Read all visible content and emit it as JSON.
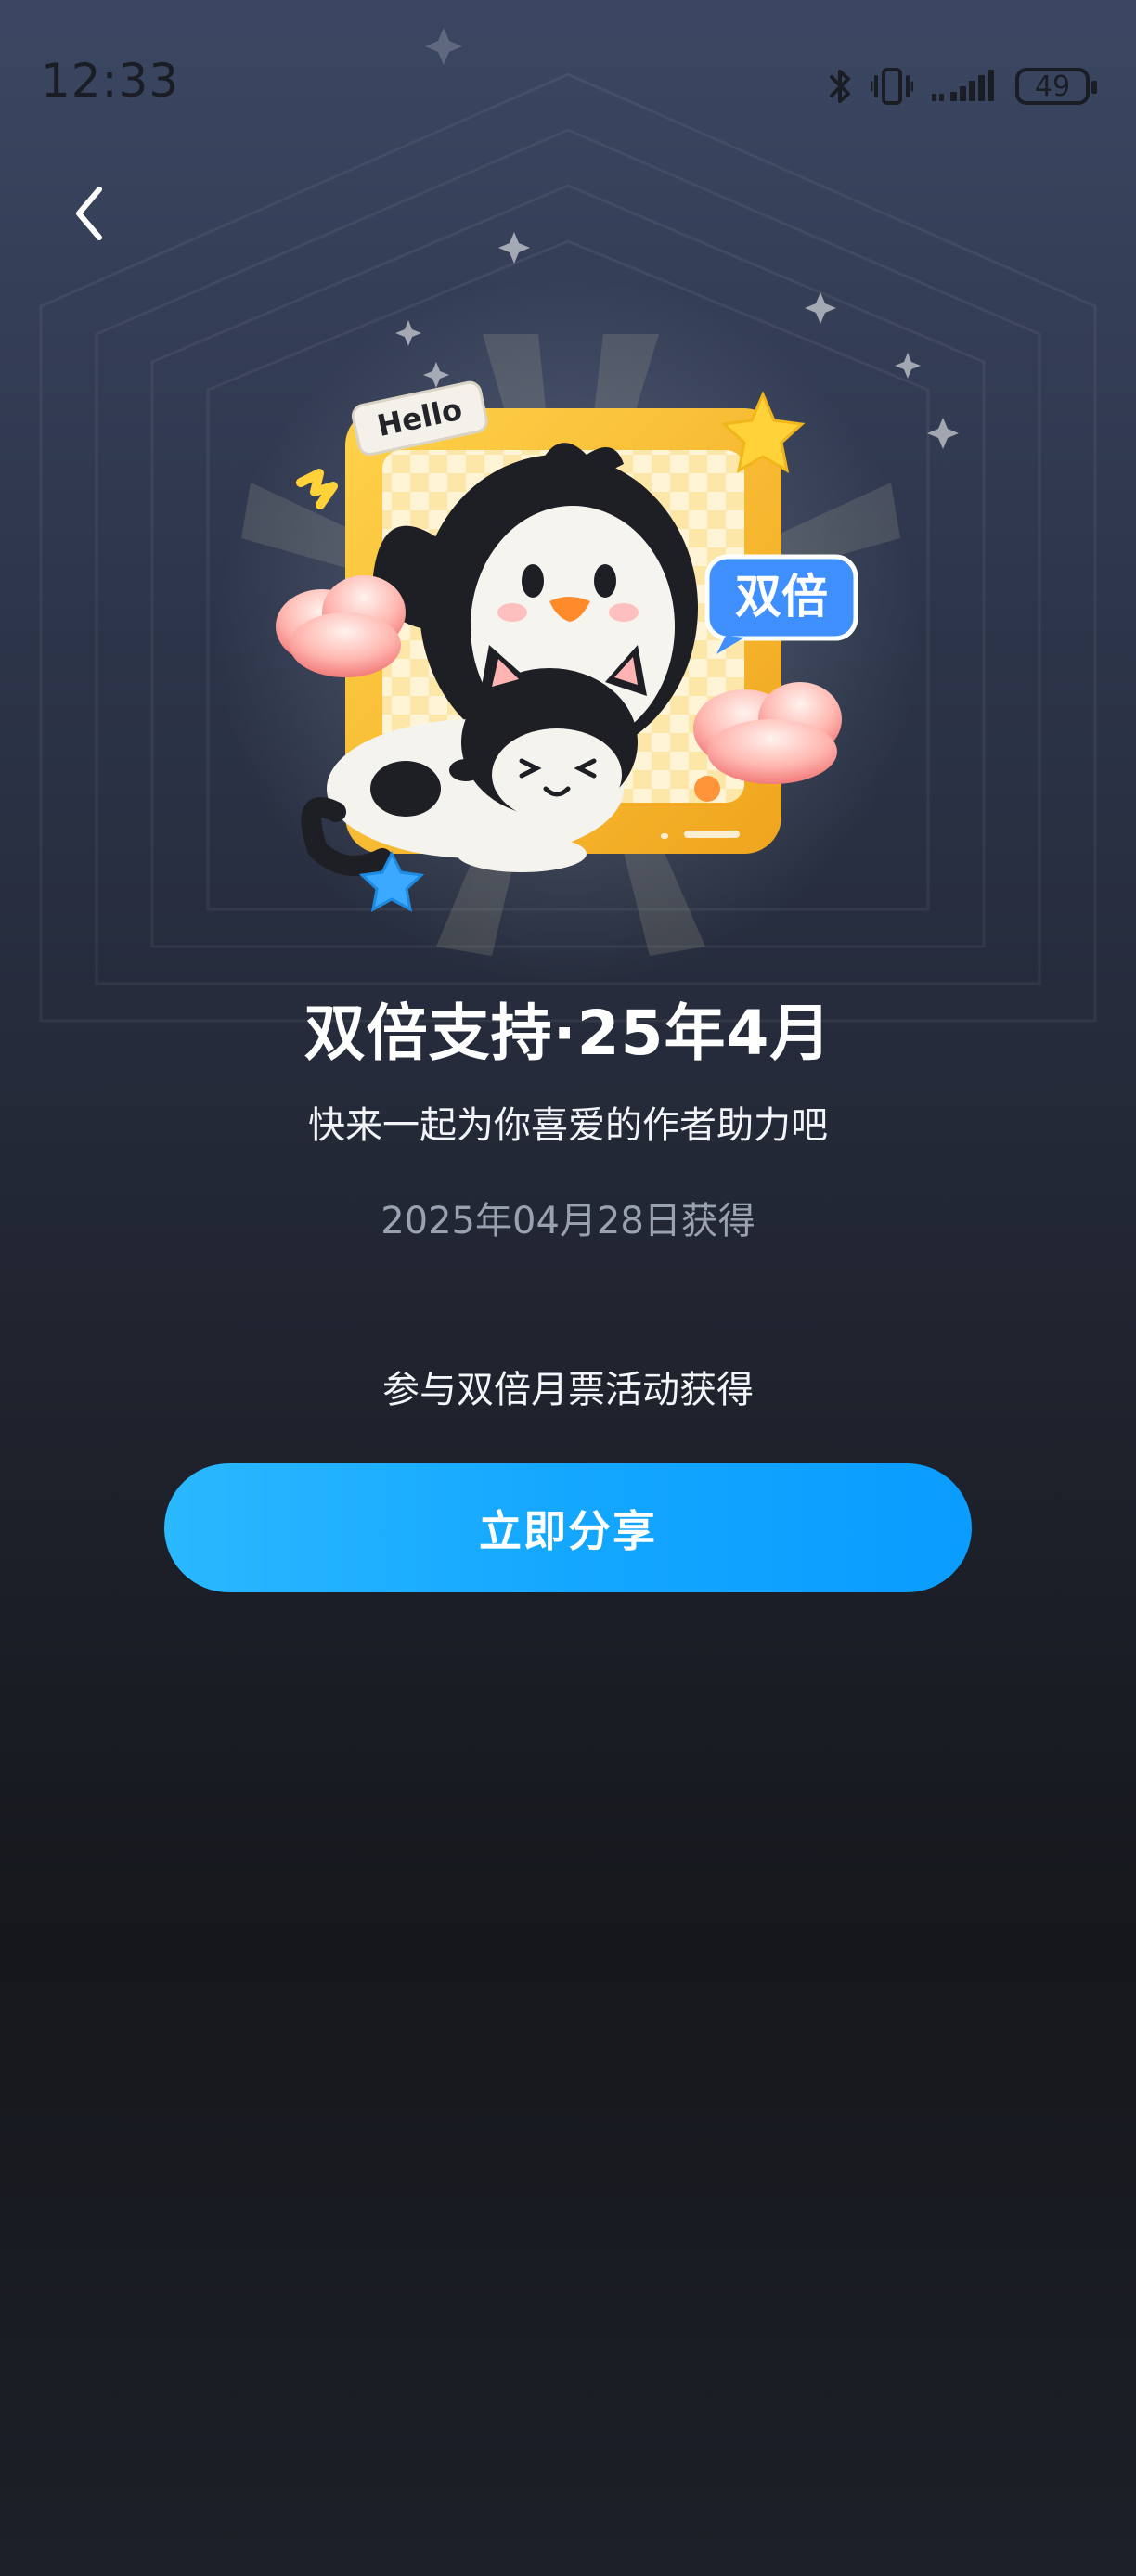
{
  "status_bar": {
    "time": "12:33",
    "battery": "49",
    "icons": [
      "bluetooth-icon",
      "vibrate-icon",
      "signal-icon",
      "battery-icon"
    ]
  },
  "nav": {
    "back_icon": "chevron-left-icon"
  },
  "badge": {
    "hello_text": "Hello",
    "tag_text": "双倍",
    "title": "双倍支持·25年4月",
    "subtitle": "快来一起为你喜爱的作者助力吧",
    "date": "2025年04月28日获得",
    "source": "参与双倍月票活动获得"
  },
  "actions": {
    "share_label": "立即分享"
  },
  "colors": {
    "accent": "#14a7ff",
    "frame": "#f4b42a",
    "background_top": "#3b4762",
    "background_bottom": "#15171c"
  }
}
